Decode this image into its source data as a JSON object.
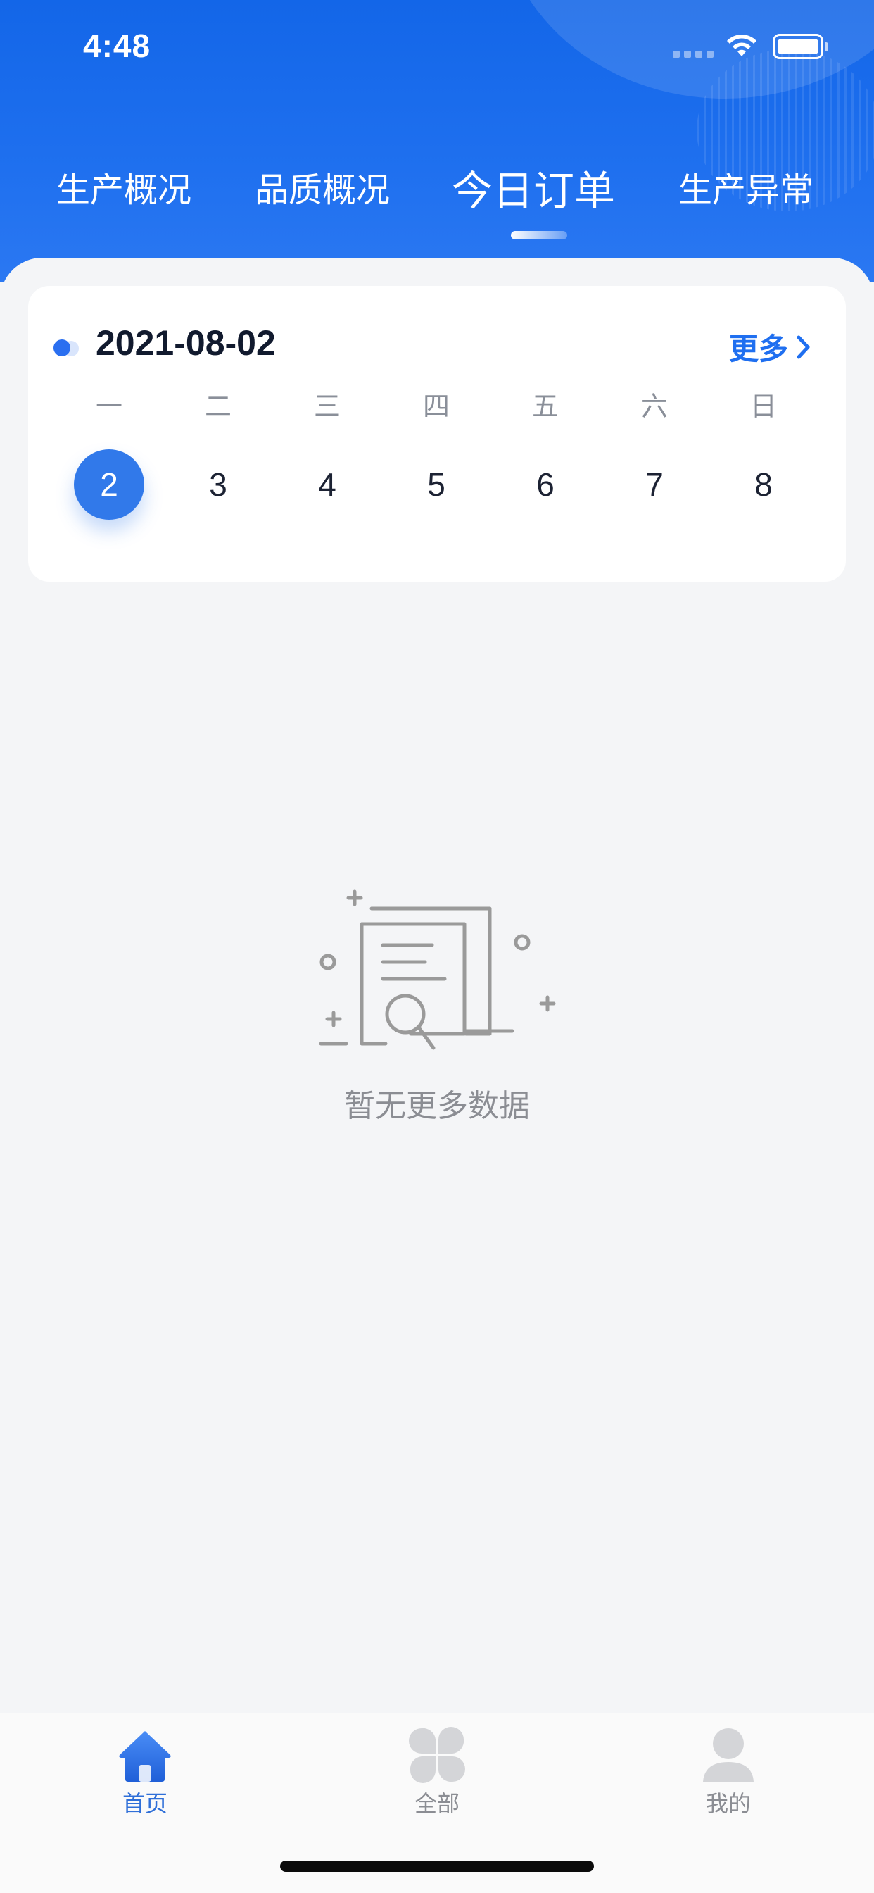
{
  "status_bar": {
    "time": "4:48"
  },
  "tabs": [
    {
      "label": "生产概况",
      "active": false
    },
    {
      "label": "品质概况",
      "active": false
    },
    {
      "label": "今日订单",
      "active": true
    },
    {
      "label": "生产异常",
      "active": false
    }
  ],
  "date_card": {
    "date": "2021-08-02",
    "more_label": "更多",
    "weekdays": [
      "一",
      "二",
      "三",
      "四",
      "五",
      "六",
      "日"
    ],
    "days": [
      "2",
      "3",
      "4",
      "5",
      "6",
      "7",
      "8"
    ],
    "selected_day": "2"
  },
  "empty_state": {
    "text": "暂无更多数据",
    "icon": "document-search-icon"
  },
  "bottom_nav": [
    {
      "label": "首页",
      "icon": "home-icon",
      "active": true
    },
    {
      "label": "全部",
      "icon": "grid-icon",
      "active": false
    },
    {
      "label": "我的",
      "icon": "user-icon",
      "active": false
    }
  ],
  "colors": {
    "header_blue": "#1366e8",
    "accent_blue": "#1f6ff0",
    "selected_day": "#3179ea",
    "background": "#f4f5f7"
  }
}
